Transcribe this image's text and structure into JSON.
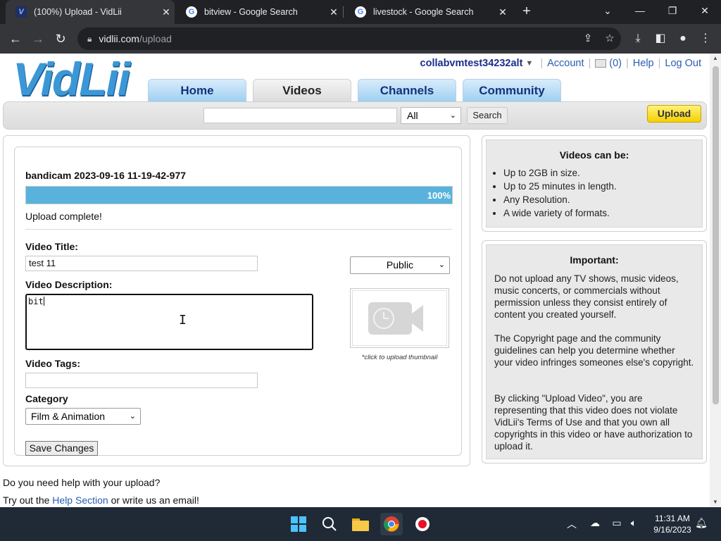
{
  "browser": {
    "tabs": [
      {
        "title": "(100%) Upload - VidLii",
        "icon": "vidlii-favicon",
        "active": true
      },
      {
        "title": "bitview - Google Search",
        "icon": "google-favicon",
        "active": false
      },
      {
        "title": "livestock - Google Search",
        "icon": "google-favicon",
        "active": false
      }
    ],
    "url_host": "vidlii.com",
    "url_path": "/upload"
  },
  "site": {
    "logo": "VidLii",
    "user": {
      "username": "collabvmtest34232alt",
      "account": "Account",
      "mail_count": "(0)",
      "help": "Help",
      "logout": "Log Out"
    },
    "nav": [
      "Home",
      "Videos",
      "Channels",
      "Community"
    ],
    "search": {
      "select_value": "All",
      "button": "Search",
      "upload": "Upload"
    }
  },
  "upload": {
    "filename": "bandicam 2023-09-16 11-19-42-977",
    "progress": 1.0,
    "progress_label": "100%",
    "status": "Upload complete!",
    "title_label": "Video Title:",
    "title_value": "test 11",
    "description_label": "Video Description:",
    "description_value": "bit",
    "tags_label": "Video Tags:",
    "tags_value": "",
    "category_label": "Category",
    "category_value": "Film & Animation",
    "privacy_value": "Public",
    "thumbnail_hint": "*click to upload thumbnail",
    "save_button": "Save Changes"
  },
  "sidebar": {
    "videos_can_be": {
      "heading": "Videos can be:",
      "items": [
        "Up to 2GB in size.",
        "Up to 25 minutes in length.",
        "Any Resolution.",
        "A wide variety of formats."
      ]
    },
    "important": {
      "heading": "Important:",
      "paragraphs": [
        "Do not upload any TV shows, music videos, music concerts, or commercials without permission unless they consist entirely of content you created yourself.",
        "The Copyright page and the community guidelines can help you determine whether your video infringes someones else's copyright.",
        "By clicking \"Upload Video\", you are representing that this video does not violate VidLii's Terms of Use and that you own all copyrights in this video or have authorization to upload it."
      ]
    }
  },
  "help": {
    "line1": "Do you need help with your upload?",
    "line2_pre": "Try out the ",
    "line2_link": "Help Section",
    "line2_post": " or write us an email!"
  },
  "taskbar": {
    "time": "11:31 AM",
    "date": "9/16/2023"
  },
  "colors": {
    "progress_fill": "#58b2dc",
    "username": "#1b2d8c",
    "link": "#2a5db0",
    "upload_button": "#f5d000"
  }
}
